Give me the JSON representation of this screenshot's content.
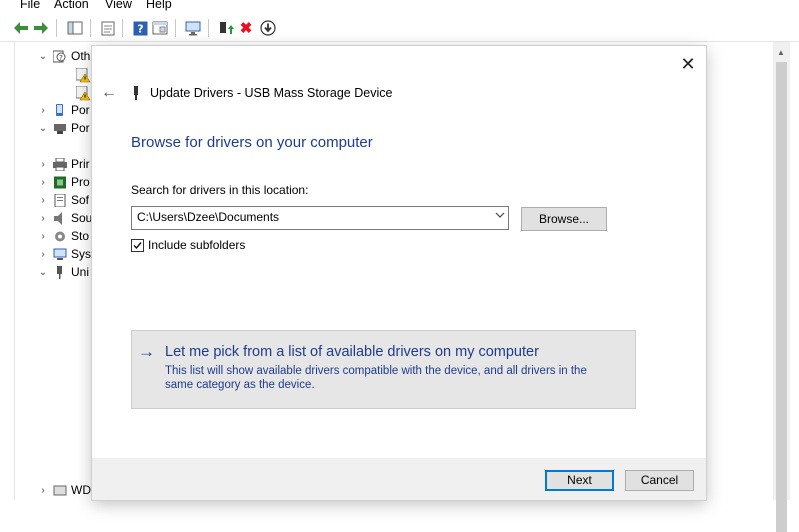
{
  "menu": [
    "File",
    "Action",
    "View",
    "Help"
  ],
  "toolbar": {
    "icons": [
      "back-arrow-icon",
      "forward-arrow-icon",
      "show-hide-tree-icon",
      "properties-icon",
      "help-icon",
      "view-icon",
      "scan-hardware-icon",
      "update-driver-icon",
      "uninstall-icon",
      "disable-device-icon"
    ],
    "uninstall_glyph": "✖",
    "disable_glyph": "⬇"
  },
  "tree": {
    "categories": [
      "Oth",
      "Por",
      "Por",
      "Prir",
      "Pro",
      "Sof",
      "Sou",
      "Sto",
      "Sys",
      "Uni",
      "WD"
    ]
  },
  "dialog": {
    "title": "Update Drivers - USB Mass Storage Device",
    "heading": "Browse for drivers on your computer",
    "search_label": "Search for drivers in this location:",
    "path_value": "C:\\Users\\Dzee\\Documents",
    "browse_label": "Browse...",
    "include_subfolders_label": "Include subfolders",
    "include_subfolders_checked": true,
    "pick_title": "Let me pick from a list of available drivers on my computer",
    "pick_description": "This list will show available drivers compatible with the device, and all drivers in the same category as the device.",
    "next_label": "Next",
    "cancel_label": "Cancel",
    "close_glyph": "✕",
    "back_glyph": "←",
    "pick_arrow_glyph": "→"
  },
  "colors": {
    "accent_blue": "#1e3c8c",
    "default_button_border": "#0078d7",
    "uninstall_red": "#e81123",
    "footer_bg": "#f0f0f0"
  }
}
